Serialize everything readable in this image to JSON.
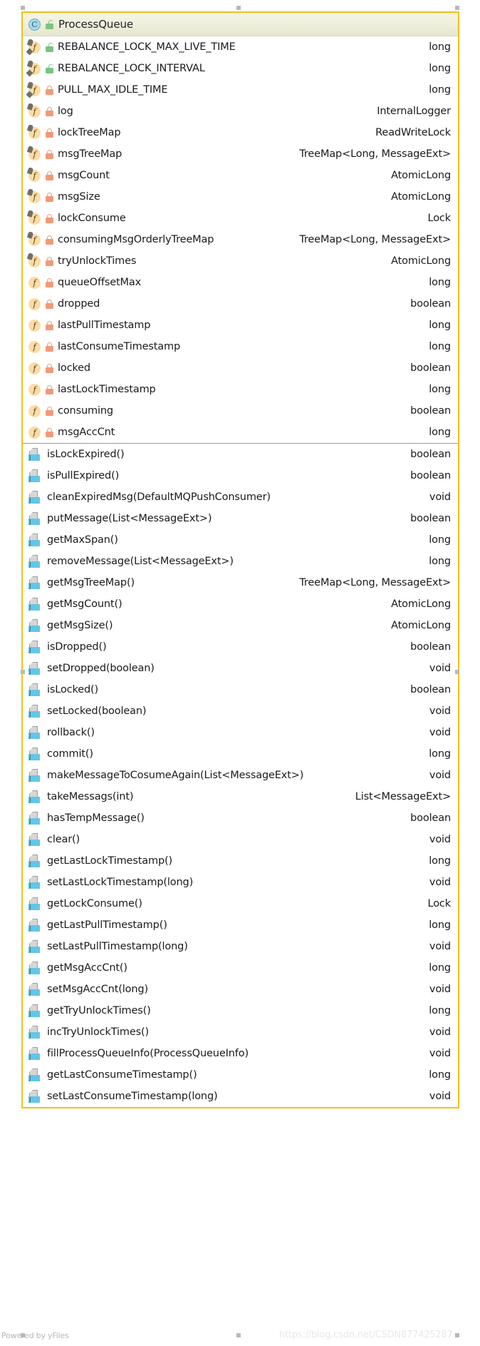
{
  "node": {
    "class_icon": "C",
    "class_visibility_icon": "unlocked-padlock-icon",
    "title": "ProcessQueue"
  },
  "fields": [
    {
      "name": "REBALANCE_LOCK_MAX_LIVE_TIME",
      "type": "long",
      "visibility": "public",
      "modifiers": "static-final"
    },
    {
      "name": "REBALANCE_LOCK_INTERVAL",
      "type": "long",
      "visibility": "public",
      "modifiers": "static-final"
    },
    {
      "name": "PULL_MAX_IDLE_TIME",
      "type": "long",
      "visibility": "private",
      "modifiers": "static-final"
    },
    {
      "name": "log",
      "type": "InternalLogger",
      "visibility": "private",
      "modifiers": "final"
    },
    {
      "name": "lockTreeMap",
      "type": "ReadWriteLock",
      "visibility": "private",
      "modifiers": "final"
    },
    {
      "name": "msgTreeMap",
      "type": "TreeMap<Long, MessageExt>",
      "visibility": "private",
      "modifiers": "final"
    },
    {
      "name": "msgCount",
      "type": "AtomicLong",
      "visibility": "private",
      "modifiers": "final"
    },
    {
      "name": "msgSize",
      "type": "AtomicLong",
      "visibility": "private",
      "modifiers": "final"
    },
    {
      "name": "lockConsume",
      "type": "Lock",
      "visibility": "private",
      "modifiers": "final"
    },
    {
      "name": "consumingMsgOrderlyTreeMap",
      "type": "TreeMap<Long, MessageExt>",
      "visibility": "private",
      "modifiers": "final"
    },
    {
      "name": "tryUnlockTimes",
      "type": "AtomicLong",
      "visibility": "private",
      "modifiers": "final"
    },
    {
      "name": "queueOffsetMax",
      "type": "long",
      "visibility": "private",
      "modifiers": "none"
    },
    {
      "name": "dropped",
      "type": "boolean",
      "visibility": "private",
      "modifiers": "none"
    },
    {
      "name": "lastPullTimestamp",
      "type": "long",
      "visibility": "private",
      "modifiers": "none"
    },
    {
      "name": "lastConsumeTimestamp",
      "type": "long",
      "visibility": "private",
      "modifiers": "none"
    },
    {
      "name": "locked",
      "type": "boolean",
      "visibility": "private",
      "modifiers": "none"
    },
    {
      "name": "lastLockTimestamp",
      "type": "long",
      "visibility": "private",
      "modifiers": "none"
    },
    {
      "name": "consuming",
      "type": "boolean",
      "visibility": "private",
      "modifiers": "none"
    },
    {
      "name": "msgAccCnt",
      "type": "long",
      "visibility": "private",
      "modifiers": "none"
    }
  ],
  "methods": [
    {
      "name": "isLockExpired()",
      "type": "boolean"
    },
    {
      "name": "isPullExpired()",
      "type": "boolean"
    },
    {
      "name": "cleanExpiredMsg(DefaultMQPushConsumer)",
      "type": "void"
    },
    {
      "name": "putMessage(List<MessageExt>)",
      "type": "boolean"
    },
    {
      "name": "getMaxSpan()",
      "type": "long"
    },
    {
      "name": "removeMessage(List<MessageExt>)",
      "type": "long"
    },
    {
      "name": "getMsgTreeMap()",
      "type": "TreeMap<Long, MessageExt>"
    },
    {
      "name": "getMsgCount()",
      "type": "AtomicLong"
    },
    {
      "name": "getMsgSize()",
      "type": "AtomicLong"
    },
    {
      "name": "isDropped()",
      "type": "boolean"
    },
    {
      "name": "setDropped(boolean)",
      "type": "void"
    },
    {
      "name": "isLocked()",
      "type": "boolean"
    },
    {
      "name": "setLocked(boolean)",
      "type": "void"
    },
    {
      "name": "rollback()",
      "type": "void"
    },
    {
      "name": "commit()",
      "type": "long"
    },
    {
      "name": "makeMessageToCosumeAgain(List<MessageExt>)",
      "type": "void"
    },
    {
      "name": "takeMessags(int)",
      "type": "List<MessageExt>"
    },
    {
      "name": "hasTempMessage()",
      "type": "boolean"
    },
    {
      "name": "clear()",
      "type": "void"
    },
    {
      "name": "getLastLockTimestamp()",
      "type": "long"
    },
    {
      "name": "setLastLockTimestamp(long)",
      "type": "void"
    },
    {
      "name": "getLockConsume()",
      "type": "Lock"
    },
    {
      "name": "getLastPullTimestamp()",
      "type": "long"
    },
    {
      "name": "setLastPullTimestamp(long)",
      "type": "void"
    },
    {
      "name": "getMsgAccCnt()",
      "type": "long"
    },
    {
      "name": "setMsgAccCnt(long)",
      "type": "void"
    },
    {
      "name": "getTryUnlockTimes()",
      "type": "long"
    },
    {
      "name": "incTryUnlockTimes()",
      "type": "void"
    },
    {
      "name": "fillProcessQueueInfo(ProcessQueueInfo)",
      "type": "void"
    },
    {
      "name": "getLastConsumeTimestamp()",
      "type": "long"
    },
    {
      "name": "setLastConsumeTimestamp(long)",
      "type": "void"
    }
  ],
  "footer": {
    "powered_by": "Powered by yFiles",
    "watermark": "https://blog.csdn.net/CSDN877425287"
  },
  "method_icon_label": "J",
  "colors": {
    "node_border": "#f0c11b",
    "header_fill": "#eeeedb",
    "class_icon_fill": "#a8d8ea",
    "field_icon_fill": "#fcdca4",
    "private_lock": "#f09a78",
    "public_lock": "#7bc47f",
    "method_icon_fill": "#63c6e8"
  }
}
